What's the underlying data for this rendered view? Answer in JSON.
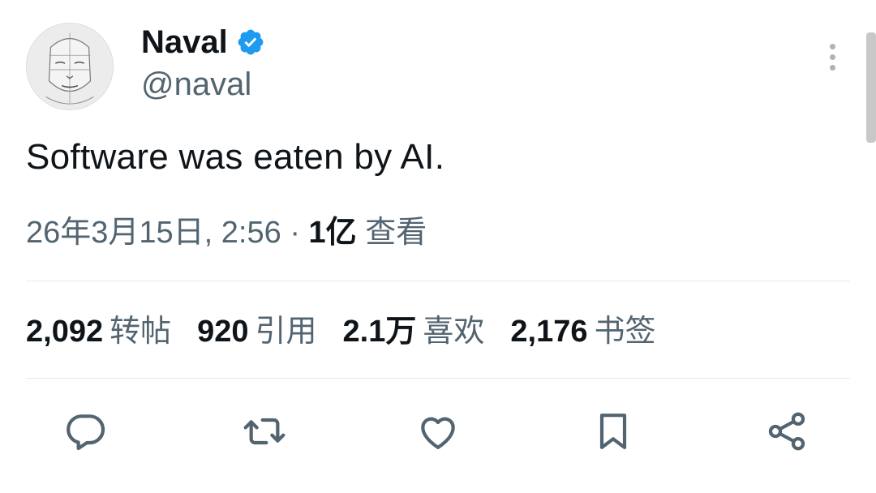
{
  "author": {
    "display_name": "Naval",
    "handle": "@naval",
    "verified": true
  },
  "tweet": {
    "text": "Software was eaten by AI."
  },
  "meta": {
    "timestamp": "26年3月15日, 2:56",
    "separator": "·",
    "views_count": "1亿",
    "views_label": "查看"
  },
  "stats": [
    {
      "value": "2,092",
      "label": "转帖"
    },
    {
      "value": "920",
      "label": "引用"
    },
    {
      "value": "2.1万",
      "label": "喜欢"
    },
    {
      "value": "2,176",
      "label": "书签"
    }
  ],
  "actions": [
    "reply-icon",
    "retweet-icon",
    "like-icon",
    "bookmark-icon",
    "share-icon"
  ],
  "colors": {
    "text": "#0f1419",
    "secondary": "#536471",
    "verified": "#1d9bf0",
    "divider": "#e6e9ec"
  }
}
